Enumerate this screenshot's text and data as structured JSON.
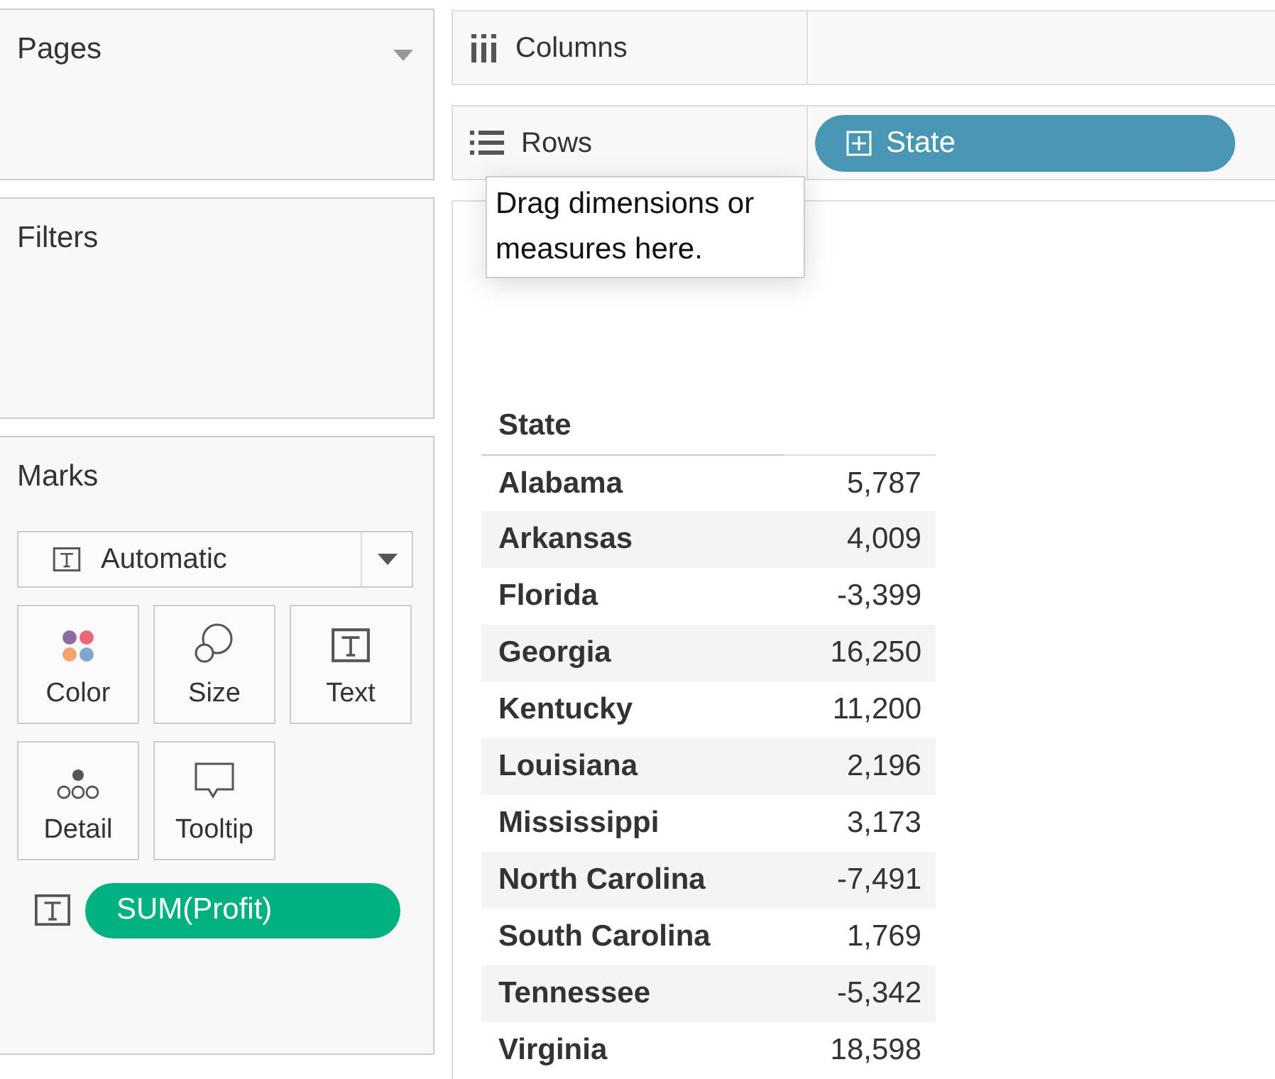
{
  "pages": {
    "title": "Pages"
  },
  "filters": {
    "title": "Filters"
  },
  "marks": {
    "title": "Marks",
    "mark_type": "Automatic",
    "cards": [
      {
        "kind": "color",
        "label": "Color"
      },
      {
        "kind": "size",
        "label": "Size"
      },
      {
        "kind": "text",
        "label": "Text"
      },
      {
        "kind": "detail",
        "label": "Detail"
      },
      {
        "kind": "tooltip",
        "label": "Tooltip"
      }
    ],
    "pills": [
      {
        "kind": "measure",
        "label": "SUM(Profit)"
      }
    ]
  },
  "columns_shelf": {
    "label": "Columns"
  },
  "rows_shelf": {
    "label": "Rows",
    "pills": [
      {
        "kind": "dimension",
        "label": "State"
      }
    ]
  },
  "tooltip": "Drag dimensions or measures here.",
  "sheet": {
    "header": "State",
    "rows": [
      {
        "state": "Alabama",
        "value": "5,787"
      },
      {
        "state": "Arkansas",
        "value": "4,009"
      },
      {
        "state": "Florida",
        "value": "-3,399"
      },
      {
        "state": "Georgia",
        "value": "16,250"
      },
      {
        "state": "Kentucky",
        "value": "11,200"
      },
      {
        "state": "Louisiana",
        "value": "2,196"
      },
      {
        "state": "Mississippi",
        "value": "3,173"
      },
      {
        "state": "North Carolina",
        "value": "-7,491"
      },
      {
        "state": "South Carolina",
        "value": "1,769"
      },
      {
        "state": "Tennessee",
        "value": "-5,342"
      },
      {
        "state": "Virginia",
        "value": "18,598"
      }
    ]
  }
}
